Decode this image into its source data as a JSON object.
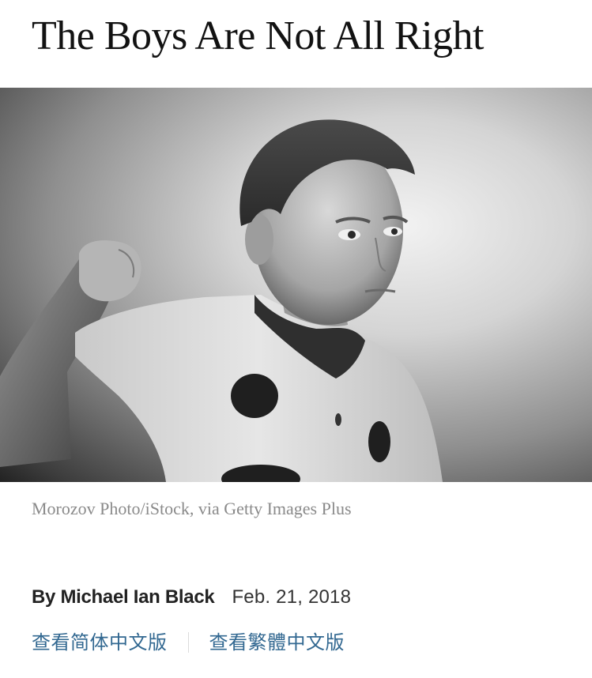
{
  "article": {
    "headline": "The Boys Are Not All Right",
    "photo_credit": "Morozov Photo/iStock, via Getty Images Plus",
    "byline": "By Michael Ian Black",
    "date": "Feb. 21, 2018"
  },
  "language_links": {
    "simplified": "查看简体中文版",
    "traditional": "查看繁體中文版"
  },
  "colors": {
    "link": "#326891",
    "caption": "#8a8a8a",
    "headline": "#121212"
  }
}
